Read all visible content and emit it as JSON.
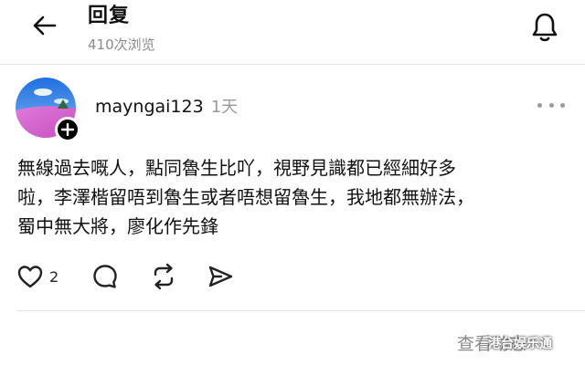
{
  "header": {
    "back_icon": "arrow-left-icon",
    "title": "回复",
    "subtitle": "410次浏览",
    "bell_icon": "bell-icon"
  },
  "post": {
    "username": "mayngai123",
    "time": "1天",
    "more_icon": "more-horizontal-icon",
    "follow_icon": "plus-icon",
    "body_lines": [
      "無線過去嘅人，點同魯生比吖，視野見識都已經細好多",
      "啦，李澤楷留唔到魯生或者唔想留魯生，我地都無辦法，",
      "蜀中無大將，廖化作先鋒"
    ],
    "actions": {
      "like_icon": "heart-icon",
      "like_count": "2",
      "reply_icon": "comment-icon",
      "repost_icon": "repost-icon",
      "share_icon": "send-icon"
    }
  },
  "footer": {
    "view_more": "查看动态",
    "watermark": "港台娱乐通"
  },
  "colors": {
    "text": "#111111",
    "muted": "#8a8a8a",
    "divider": "#e6e6e6"
  }
}
